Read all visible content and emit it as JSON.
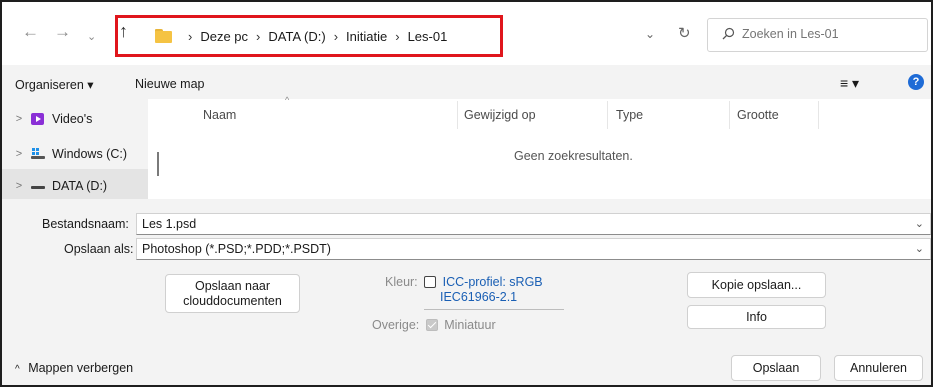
{
  "nav": {
    "back_glyph": "←",
    "forward_glyph": "→",
    "recent_glyph": "⌄",
    "up_glyph": "↑"
  },
  "breadcrumb": {
    "items": [
      "Deze pc",
      "DATA (D:)",
      "Initiatie",
      "Les-01"
    ],
    "separator": "›",
    "highlight_color": "#e0161c"
  },
  "address": {
    "dropdown_glyph": "⌄",
    "refresh_glyph": "↻"
  },
  "search": {
    "placeholder": "Zoeken in Les-01"
  },
  "toolbar": {
    "organize_label": "Organiseren ▾",
    "new_folder_label": "Nieuwe map",
    "view_glyph": "≡ ▾",
    "help_glyph": "?"
  },
  "sidebar": {
    "items": [
      {
        "label": "Video's",
        "chevron": ">",
        "icon": "videos-icon"
      },
      {
        "label": "Windows (C:)",
        "chevron": ">",
        "icon": "windows-drive-icon"
      },
      {
        "label": "DATA (D:)",
        "chevron": ">",
        "icon": "data-drive-icon"
      }
    ]
  },
  "file_list": {
    "columns": [
      "Naam",
      "Gewijzigd op",
      "Type",
      "Grootte"
    ],
    "sort_glyph": "^",
    "empty_message": "Geen zoekresultaten."
  },
  "form": {
    "filename_label": "Bestandsnaam:",
    "filename_value": "Les 1.psd",
    "savetype_label": "Opslaan als:",
    "savetype_value": "Photoshop (*.PSD;*.PDD;*.PSDT)",
    "chevron": "⌄"
  },
  "options": {
    "cloud_button_label": "Opslaan naar clouddocumenten",
    "color_label": "Kleur:",
    "icc_label_line1": "ICC-profiel:  sRGB",
    "icc_label_line2": "IEC61966-2.1",
    "other_label": "Overige:",
    "thumbnail_label": "Miniatuur",
    "copy_button_label": "Kopie opslaan...",
    "info_button_label": "Info"
  },
  "footer": {
    "hide_folders_label": "Mappen verbergen",
    "hide_folders_glyph": "^",
    "save_label": "Opslaan",
    "cancel_label": "Annuleren"
  }
}
